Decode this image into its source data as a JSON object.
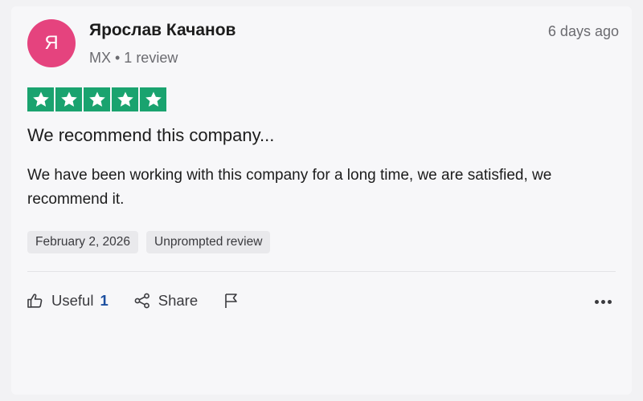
{
  "author": {
    "initial": "Я",
    "name": "Ярослав Качанов",
    "meta": "MX • 1 review",
    "avatar_color": "#e5437e"
  },
  "review": {
    "relative_date": "6 days ago",
    "rating": 5,
    "max_rating": 5,
    "star_color": "#1aa36f",
    "title": "We recommend this company...",
    "body": "We have been working with this company for a long time, we are satisfied, we recommend it.",
    "tags": [
      "February 2, 2026",
      "Unprompted review"
    ]
  },
  "actions": {
    "useful_label": "Useful",
    "useful_count": "1",
    "share_label": "Share",
    "useful_icon": "thumbs-up-icon",
    "share_icon": "share-icon",
    "report_icon": "flag-icon",
    "more_icon": "more-dots-icon"
  }
}
